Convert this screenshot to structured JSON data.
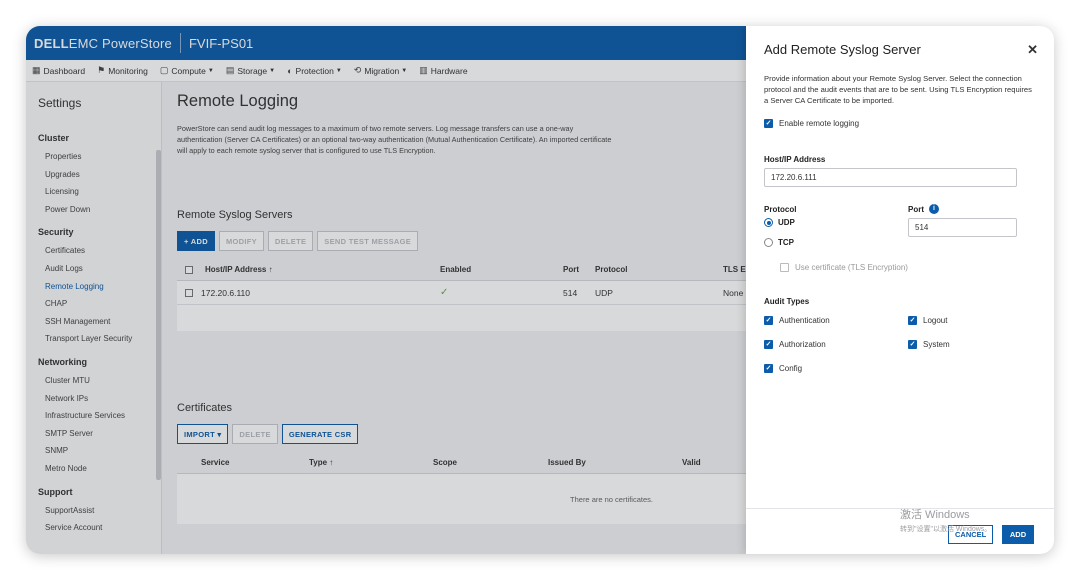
{
  "header": {
    "brand_dell": "DELL",
    "brand_rest": "EMC PowerStore",
    "cluster": "FVIF-PS01"
  },
  "menu": [
    {
      "icon": "dashboard-icon",
      "glyph": "▦",
      "label": "Dashboard",
      "caret": false
    },
    {
      "icon": "monitoring-icon",
      "glyph": "⚑",
      "label": "Monitoring",
      "caret": false
    },
    {
      "icon": "compute-icon",
      "glyph": "▢",
      "label": "Compute",
      "caret": true
    },
    {
      "icon": "storage-icon",
      "glyph": "▤",
      "label": "Storage",
      "caret": true
    },
    {
      "icon": "protection-icon",
      "glyph": "◐",
      "label": "Protection",
      "caret": true
    },
    {
      "icon": "migration-icon",
      "glyph": "⟲",
      "label": "Migration",
      "caret": true
    },
    {
      "icon": "hardware-icon",
      "glyph": "▥",
      "label": "Hardware",
      "caret": false
    }
  ],
  "sidebar": {
    "title": "Settings",
    "sections": [
      {
        "name": "Cluster",
        "items": [
          "Properties",
          "Upgrades",
          "Licensing",
          "Power Down"
        ]
      },
      {
        "name": "Security",
        "items": [
          "Certificates",
          "Audit Logs",
          "Remote Logging",
          "CHAP",
          "SSH Management",
          "Transport Layer Security"
        ]
      },
      {
        "name": "Networking",
        "items": [
          "Cluster MTU",
          "Network IPs",
          "Infrastructure Services",
          "SMTP Server",
          "SNMP",
          "Metro Node"
        ]
      },
      {
        "name": "Support",
        "items": [
          "SupportAssist",
          "Service Account"
        ]
      }
    ],
    "active": "Remote Logging"
  },
  "main": {
    "title": "Remote Logging",
    "description": "PowerStore can send audit log messages to a maximum of two remote servers. Log message transfers can use a one-way authentication (Server CA Certificates) or an optional two-way authentication (Mutual Authentication Certificate). An imported certificate will apply to each remote syslog server that is configured to use TLS Encryption.",
    "syslog": {
      "title": "Remote Syslog Servers",
      "buttons": {
        "add": "+ ADD",
        "modify": "MODIFY",
        "delete": "DELETE",
        "send_test": "SEND TEST MESSAGE"
      },
      "columns": {
        "host": "Host/IP Address ↑",
        "enabled": "Enabled",
        "port": "Port",
        "protocol": "Protocol",
        "tls": "TLS En"
      },
      "rows": [
        {
          "host": "172.20.6.110",
          "enabled": "✓",
          "port": "514",
          "protocol": "UDP",
          "tls": "None"
        }
      ]
    },
    "certificates": {
      "title": "Certificates",
      "buttons": {
        "import": "IMPORT ▾",
        "delete": "DELETE",
        "generate": "GENERATE CSR"
      },
      "columns": {
        "service": "Service",
        "type": "Type ↑",
        "scope": "Scope",
        "issued_by": "Issued By",
        "valid": "Valid"
      },
      "empty": "There are no certificates."
    }
  },
  "panel": {
    "title": "Add Remote Syslog Server",
    "close": "✕",
    "description": "Provide information about your Remote Syslog Server. Select the connection protocol and the audit events that are to be sent. Using TLS Encryption requires a Server CA Certificate to be imported.",
    "enable_label": "Enable remote logging",
    "host_label": "Host/IP Address",
    "host_value": "172.20.6.111",
    "protocol_label": "Protocol",
    "udp": "UDP",
    "tcp": "TCP",
    "port_label": "Port",
    "port_value": "514",
    "tls_label": "Use certificate (TLS Encryption)",
    "audit_label": "Audit Types",
    "audit": {
      "authentication": "Authentication",
      "logout": "Logout",
      "authorization": "Authorization",
      "system": "System",
      "config": "Config"
    },
    "cancel": "CANCEL",
    "add": "ADD"
  },
  "watermark": {
    "line1": "激活 Windows",
    "line2": "转到\"设置\"以激活 Windows。"
  },
  "colors": {
    "brand": "#0b5cab",
    "enabled_check": "#6aa84f"
  }
}
